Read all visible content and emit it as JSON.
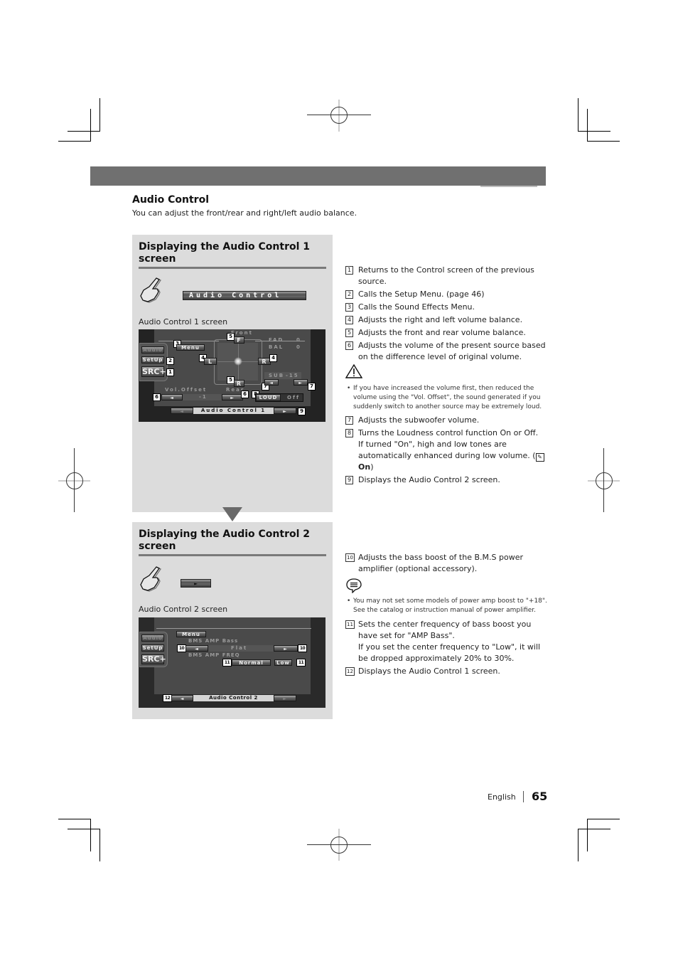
{
  "section": {
    "title": "Audio Control",
    "description": "You can adjust the front/rear and right/left audio balance."
  },
  "panel1": {
    "title": "Displaying the Audio Control 1 screen",
    "button_label": "Audio Control",
    "caption": "Audio Control 1 screen",
    "screen": {
      "sidebar": {
        "audio": "Audio",
        "setup": "SetUp",
        "src": "SRC+"
      },
      "menu": "Menu",
      "front_label": "Front",
      "rear_label": "Rear",
      "f_btn": "F",
      "r_btn_bottom": "R",
      "l_btn": "L",
      "r_btn": "R",
      "fad_label": "FAD",
      "fad_value": "0",
      "bal_label": "BAL",
      "bal_value": "0",
      "sub_label": "SUB",
      "sub_value": "-15",
      "vol_offset_label": "Vol.Offset",
      "vol_offset_value": "-1",
      "loud_label": "LOUD",
      "loud_value": "Off",
      "footer_title": "Audio Control 1",
      "left_arrow": "◄",
      "right_arrow": "►",
      "markers": [
        "1",
        "2",
        "3",
        "4",
        "5",
        "6",
        "7",
        "8",
        "9"
      ]
    }
  },
  "panel2": {
    "title": "Displaying the Audio Control 2 screen",
    "button_label": "►",
    "caption": "Audio Control 2 screen",
    "screen": {
      "sidebar": {
        "audio": "Audio",
        "setup": "SetUp",
        "src": "SRC+"
      },
      "menu": "Menu",
      "bms_bass_label": "BMS AMP Bass",
      "bms_bass_value": "Flat",
      "bms_freq_label": "BMS AMP FREQ",
      "freq_normal": "Normal",
      "freq_low": "Low",
      "footer_title": "Audio Control 2",
      "left_arrow": "◄",
      "right_arrow": "►",
      "markers": [
        "10",
        "11",
        "12"
      ]
    }
  },
  "list1": [
    {
      "n": "1",
      "text": "Returns to the Control screen of the previous source."
    },
    {
      "n": "2",
      "text": "Calls the Setup Menu. (page 46)"
    },
    {
      "n": "3",
      "text": "Calls the Sound Effects Menu."
    },
    {
      "n": "4",
      "text": "Adjusts the right and left volume balance."
    },
    {
      "n": "5",
      "text": "Adjusts the front and rear volume balance."
    },
    {
      "n": "6",
      "text": "Adjusts the volume of the present source based on the difference level of original volume."
    }
  ],
  "warning_icon": "warning-triangle-icon",
  "warning_note": "If you have increased the volume first, then reduced the volume using the \"Vol. Offset\", the sound generated if you suddenly switch to another source may be extremely loud.",
  "list2": [
    {
      "n": "7",
      "text": "Adjusts the subwoofer volume."
    },
    {
      "n": "8",
      "text": "Turns the Loudness control function On or Off.",
      "text2": "If turned \"On\", high and low tones are automatically enhanced during low volume. (",
      "on": "On",
      "close": ")"
    },
    {
      "n": "9",
      "text": "Displays the Audio Control 2 screen."
    }
  ],
  "list3": [
    {
      "n": "10",
      "text": "Adjusts the bass boost of the B.M.S power amplifier (optional accessory)."
    }
  ],
  "note_icon": "note-speech-bubble-icon",
  "tip_note": "You may not set some models of power amp boost to \"+18\". See the catalog or instruction manual of power amplifier.",
  "list4": [
    {
      "n": "11",
      "text": "Sets the center frequency of bass boost you have set for \"AMP Bass\".",
      "text2": "If you set the center frequency to \"Low\", it will be dropped approximately 20% to 30%."
    },
    {
      "n": "12",
      "text": "Displays the Audio Control 1 screen."
    }
  ],
  "footer": {
    "language": "English",
    "page": "65"
  },
  "colors": {
    "header_bar": "#707070",
    "panel_bg": "#dcdcdc",
    "screen_bg": "#232323"
  }
}
